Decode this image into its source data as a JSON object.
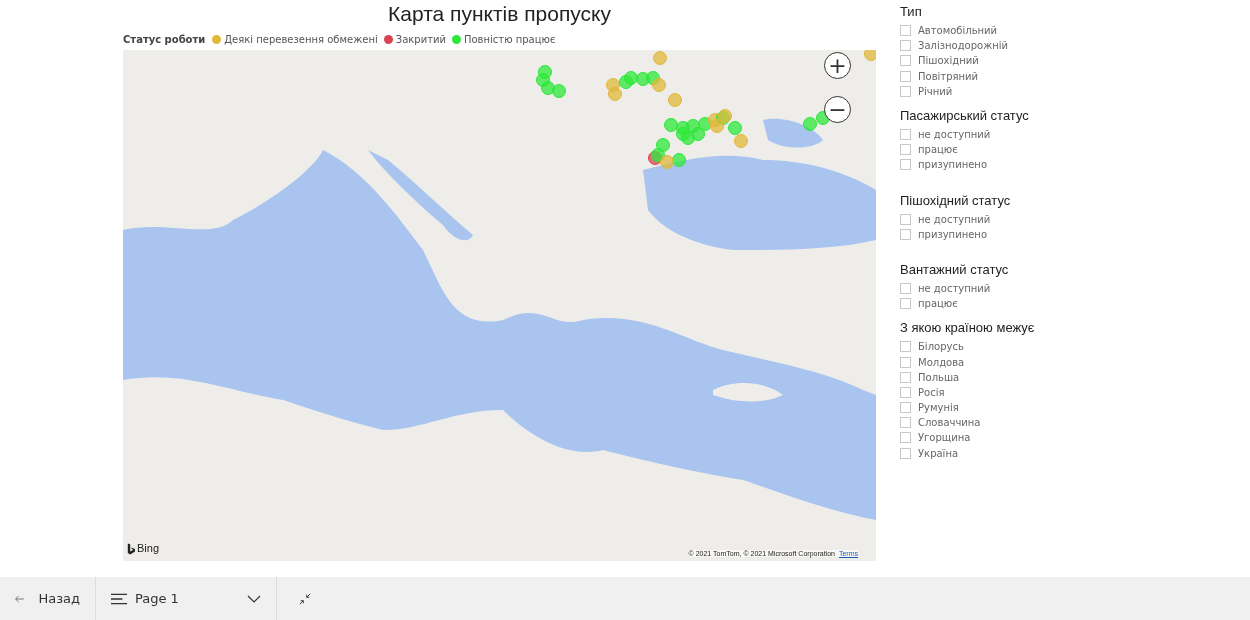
{
  "report": {
    "title": "Карта пунктів пропуску"
  },
  "legend": {
    "title": "Статус роботи",
    "items": [
      {
        "label": "Деякі перевезення обмежені",
        "color": "#e0b83a"
      },
      {
        "label": "Закритий",
        "color": "#d64550"
      },
      {
        "label": "Повністю працює",
        "color": "#2de83a"
      }
    ]
  },
  "map": {
    "zoom_in": "+",
    "zoom_out": "−",
    "provider": "Bing",
    "copyright": "© 2021 TomTom, © 2021 Microsoft Corporation",
    "terms_link": "Terms"
  },
  "filters": [
    {
      "title": "Тип",
      "options": [
        {
          "label": "Автомобільний",
          "checked": false
        },
        {
          "label": "Залізнодорожній",
          "checked": false
        },
        {
          "label": "Пішохідний",
          "checked": false
        },
        {
          "label": "Повітряний",
          "checked": false
        },
        {
          "label": "Річний",
          "checked": false
        }
      ]
    },
    {
      "title": "Пасажирський статус",
      "options": [
        {
          "label": "не доступний",
          "checked": false
        },
        {
          "label": "працює",
          "checked": false
        },
        {
          "label": "призупинено",
          "checked": false
        }
      ]
    },
    {
      "title": "Пішохідний статус",
      "options": [
        {
          "label": "не доступний",
          "checked": false
        },
        {
          "label": "призупинено",
          "checked": false
        }
      ]
    },
    {
      "title": "Вантажний статус",
      "options": [
        {
          "label": "не доступний",
          "checked": false
        },
        {
          "label": "працює",
          "checked": false
        }
      ]
    },
    {
      "title": "З якою країною межує",
      "options": [
        {
          "label": "Білорусь",
          "checked": false
        },
        {
          "label": "Молдова",
          "checked": false
        },
        {
          "label": "Польша",
          "checked": false
        },
        {
          "label": "Росія",
          "checked": false
        },
        {
          "label": "Румунія",
          "checked": false
        },
        {
          "label": "Словаччина",
          "checked": false
        },
        {
          "label": "Угорщина",
          "checked": false
        },
        {
          "label": "Україна",
          "checked": false
        }
      ]
    }
  ],
  "footer": {
    "back": "Назад",
    "page": "Page 1"
  }
}
